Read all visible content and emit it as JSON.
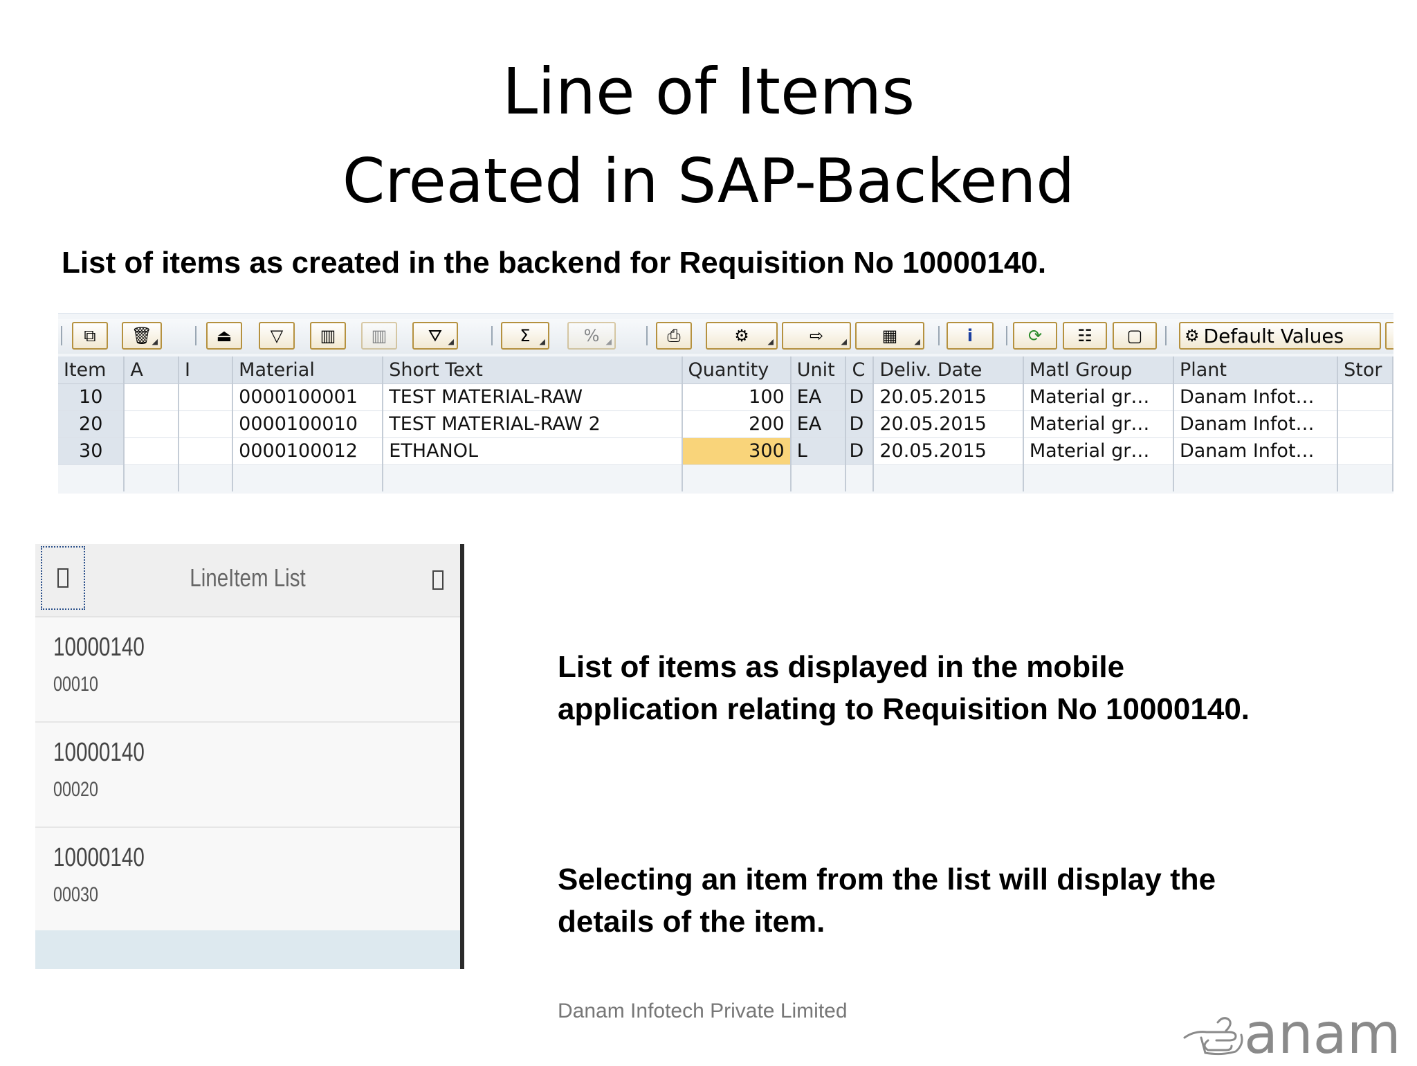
{
  "slide": {
    "title_line1": "Line of Items",
    "title_line2": "Created in SAP-Backend",
    "intro": "List of items as created in the backend for Requisition No 10000140.",
    "body_text_1": "List of items as displayed in the mobile application relating to Requisition No 10000140.",
    "body_text_2": "Selecting an item from the list will display the details of the item.",
    "footer": "Danam Infotech Private Limited",
    "logo_text": "anam"
  },
  "sap_toolbar": {
    "default_values_label": "Default Values"
  },
  "sap_table": {
    "columns": [
      "Item",
      "A",
      "I",
      "Material",
      "Short Text",
      "Quantity",
      "Unit",
      "C",
      "Deliv. Date",
      "Matl Group",
      "Plant",
      "Stor"
    ],
    "rows": [
      {
        "item": "10",
        "a": "",
        "i": "",
        "material": "0000100001",
        "short_text": "TEST MATERIAL-RAW",
        "quantity": "100",
        "unit": "EA",
        "c": "D",
        "deliv_date": "20.05.2015",
        "matl_group": "Material gr…",
        "plant": "Danam Infot…",
        "stor": ""
      },
      {
        "item": "20",
        "a": "",
        "i": "",
        "material": "0000100010",
        "short_text": "TEST MATERIAL-RAW 2",
        "quantity": "200",
        "unit": "EA",
        "c": "D",
        "deliv_date": "20.05.2015",
        "matl_group": "Material gr…",
        "plant": "Danam Infot…",
        "stor": ""
      },
      {
        "item": "30",
        "a": "",
        "i": "",
        "material": "0000100012",
        "short_text": "ETHANOL",
        "quantity": "300",
        "unit": "L",
        "c": "D",
        "deliv_date": "20.05.2015",
        "matl_group": "Material gr…",
        "plant": "Danam Infot…",
        "stor": ""
      }
    ],
    "highlight_color": "#f9d47a"
  },
  "mobile_list": {
    "title": "LineItem List",
    "items": [
      {
        "requisition": "10000140",
        "line": "00010"
      },
      {
        "requisition": "10000140",
        "line": "00020"
      },
      {
        "requisition": "10000140",
        "line": "00030"
      }
    ]
  }
}
